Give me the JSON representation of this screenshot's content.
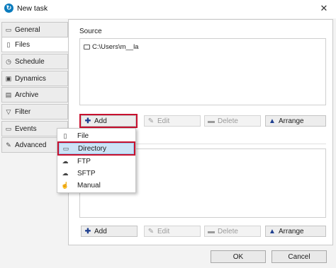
{
  "window": {
    "title": "New task",
    "app_icon": "app-logo-icon",
    "close_glyph": "✕"
  },
  "tabs": [
    {
      "label": "General",
      "icon": "general-icon",
      "glyph": "▭"
    },
    {
      "label": "Files",
      "icon": "files-icon",
      "glyph": "▯"
    },
    {
      "label": "Schedule",
      "icon": "schedule-icon",
      "glyph": "◷"
    },
    {
      "label": "Dynamics",
      "icon": "dynamics-icon",
      "glyph": "▣"
    },
    {
      "label": "Archive",
      "icon": "archive-icon",
      "glyph": "▤"
    },
    {
      "label": "Filter",
      "icon": "filter-icon",
      "glyph": "▽"
    },
    {
      "label": "Events",
      "icon": "events-icon",
      "glyph": "▭"
    },
    {
      "label": "Advanced",
      "icon": "wrench-icon",
      "glyph": "✎"
    }
  ],
  "active_tab": "Files",
  "source": {
    "label": "Source",
    "items": [
      {
        "path": "C:\\Users\\m__la",
        "icon": "folder-icon"
      }
    ]
  },
  "source_buttons": {
    "add": "Add",
    "edit": "Edit",
    "delete": "Delete",
    "arrange": "Arrange"
  },
  "dest_buttons": {
    "add": "Add",
    "edit": "Edit",
    "delete": "Delete",
    "arrange": "Arrange"
  },
  "add_menu": [
    {
      "label": "File",
      "icon": "file-icon",
      "glyph": "▯"
    },
    {
      "label": "Directory",
      "icon": "folder-icon",
      "glyph": "▭"
    },
    {
      "label": "FTP",
      "icon": "cloud-icon",
      "glyph": "☁"
    },
    {
      "label": "SFTP",
      "icon": "cloud-lock-icon",
      "glyph": "☁"
    },
    {
      "label": "Manual",
      "icon": "hand-icon",
      "glyph": "☝"
    }
  ],
  "dialog": {
    "ok": "OK",
    "cancel": "Cancel"
  },
  "colors": {
    "highlight": "#c8102e",
    "accent": "#0a7bbd",
    "menu_selected": "#cde3f6"
  }
}
